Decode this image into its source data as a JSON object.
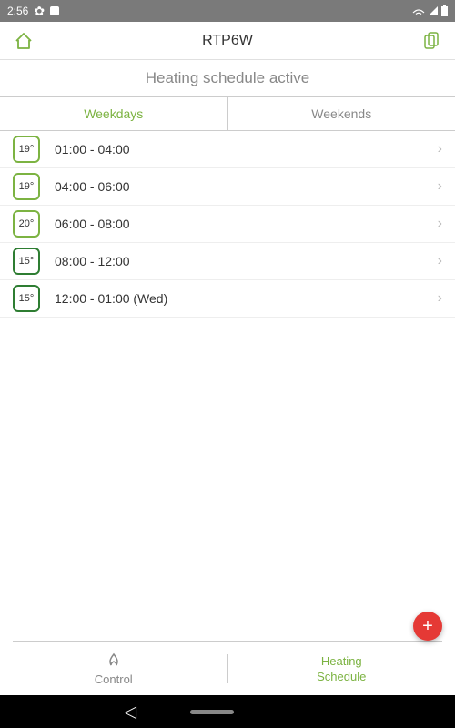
{
  "status": {
    "time": "2:56"
  },
  "header": {
    "title": "RTP6W"
  },
  "subtitle": "Heating schedule active",
  "tabs": {
    "weekdays": "Weekdays",
    "weekends": "Weekends"
  },
  "schedule": [
    {
      "temp": "19°",
      "time": "01:00 - 04:00",
      "dark": false
    },
    {
      "temp": "19°",
      "time": "04:00 - 06:00",
      "dark": false
    },
    {
      "temp": "20°",
      "time": "06:00 - 08:00",
      "dark": false
    },
    {
      "temp": "15°",
      "time": "08:00 - 12:00",
      "dark": true
    },
    {
      "temp": "15°",
      "time": "12:00 - 01:00 (Wed)",
      "dark": true
    }
  ],
  "bottomNav": {
    "control": "Control",
    "heating": "Heating",
    "schedule": "Schedule"
  }
}
